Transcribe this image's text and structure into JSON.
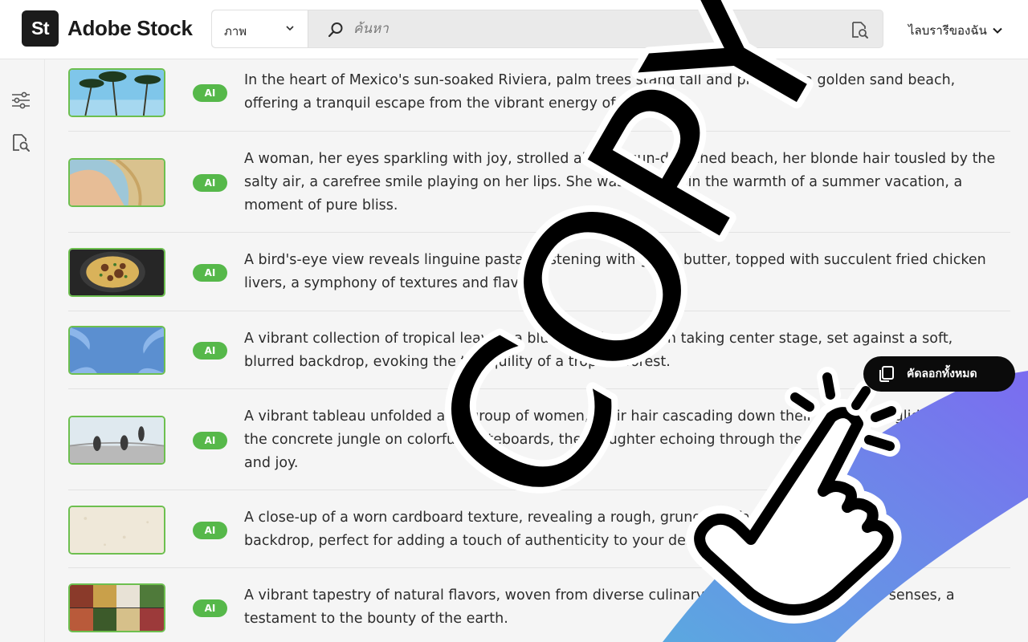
{
  "header": {
    "logo_mark": "St",
    "logo_text": "Adobe Stock",
    "type_select": "ภาพ",
    "search_placeholder": "ค้นหา",
    "library_label": "ไลบรารีของฉัน"
  },
  "rows": [
    {
      "badge": "AI",
      "text": "In the heart of Mexico's sun-soaked Riviera, palm trees stand tall and proud on a golden sand beach, offering a tranquil escape from the vibrant energy of the day."
    },
    {
      "badge": "AI",
      "text": "A woman, her eyes sparkling with joy, strolled along a sun-drenched beach, her blonde hair tousled by the salty air, a carefree smile playing on her lips. She was basking in the warmth of a summer vacation, a moment of pure bliss."
    },
    {
      "badge": "AI",
      "text": "A bird's-eye view reveals linguine pasta, glistening with garlic butter, topped with succulent fried chicken livers, a symphony of textures and flavors."
    },
    {
      "badge": "AI",
      "text": "A vibrant collection of tropical leaves, a blue-tinted specimen taking center stage, set against a soft, blurred backdrop, evoking the tranquility of a tropical forest."
    },
    {
      "badge": "AI",
      "text": "A vibrant tableau unfolded as a group of women, their hair cascading down their shoulders, glided across the concrete jungle on colorful skateboards, their laughter echoing through the air, a symphony of freedom and joy."
    },
    {
      "badge": "AI",
      "text": "A close-up of a worn cardboard texture, revealing a rough, grungy surface, ideal for a vintage or retro backdrop, perfect for adding a touch of authenticity to your designs."
    },
    {
      "badge": "AI",
      "text": "A vibrant tapestry of natural flavors, woven from diverse culinary traditions, a feast for the senses, a testament to the bounty of the earth."
    }
  ],
  "copy_all_label": "คัดลอกทั้งหมด",
  "overlay_text": "COPY",
  "colors": {
    "ai_badge": "#56b84a",
    "thumb_border": "#6dbf4f",
    "button_bg": "#0b0b0b",
    "gradient_start": "#5ba8e0",
    "gradient_end": "#7b6cf0"
  }
}
